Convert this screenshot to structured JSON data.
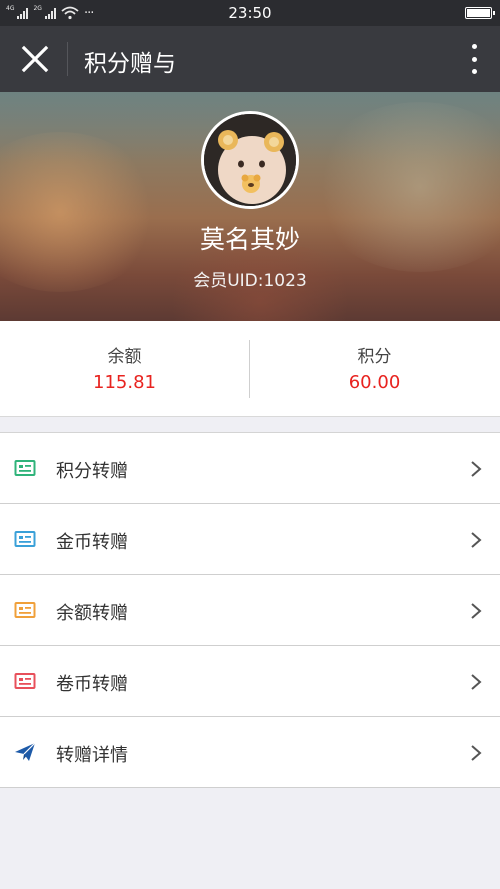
{
  "status_bar": {
    "network_1": "4G",
    "network_2": "2G",
    "more": "···",
    "time": "23:50"
  },
  "app_bar": {
    "title": "积分赠与"
  },
  "profile": {
    "nickname": "莫名其妙",
    "member_uid": "会员UID:1023"
  },
  "stats": {
    "balance_label": "余额",
    "balance_value": "115.81",
    "points_label": "积分",
    "points_value": "60.00"
  },
  "menu": [
    {
      "label": "积分转赠",
      "icon": "card-icon",
      "icon_color": "#2fb37a"
    },
    {
      "label": "金币转赠",
      "icon": "card-icon",
      "icon_color": "#3aa0d8"
    },
    {
      "label": "余额转赠",
      "icon": "card-icon",
      "icon_color": "#f0a03a"
    },
    {
      "label": "卷币转赠",
      "icon": "card-icon",
      "icon_color": "#e8505b"
    },
    {
      "label": "转赠详情",
      "icon": "paper-plane-icon",
      "icon_color": "#1d5aa8"
    }
  ],
  "colors": {
    "status_bar_bg": "#2b2c30",
    "app_bar_bg": "#393a3f",
    "value_red": "#e8231f",
    "page_bg": "#efeff4"
  }
}
